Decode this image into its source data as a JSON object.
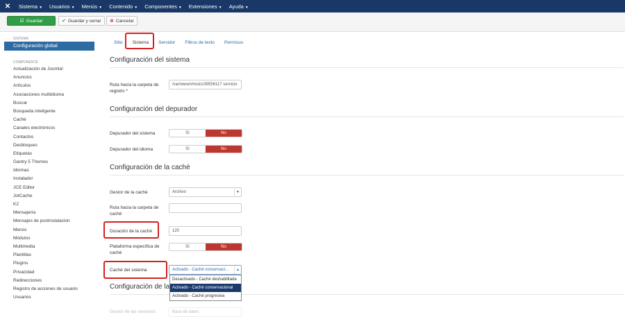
{
  "topbar": {
    "logo": "✕",
    "menu": [
      "Sistema",
      "Usuarios",
      "Menús",
      "Contenido",
      "Componentes",
      "Extensiones",
      "Ayuda"
    ]
  },
  "toolbar": {
    "save_label": "Guardar",
    "save_close_label": "Guardar y cerrar",
    "cancel_label": "Cancelar"
  },
  "sidebar": {
    "system_header": "SISTEMA",
    "active_item": "Configuración global",
    "component_header": "COMPONENTE",
    "items": [
      "Actualización de Joomla!",
      "Anuncios",
      "Artículos",
      "Asociaciones multiidioma",
      "Buscar",
      "Búsqueda inteligente",
      "Caché",
      "Canales electrónicos",
      "Contactos",
      "Desbloqueo",
      "Etiquetas",
      "Gantry 5 Themes",
      "Idiomas",
      "Instalador",
      "JCE Editor",
      "JotCache",
      "K2",
      "Mensajería",
      "Mensajes de postinstalación",
      "Menús",
      "Módulos",
      "Multimedia",
      "Plantillas",
      "Plugins",
      "Privacidad",
      "Redirecciones",
      "Registro de acciones de usuario",
      "Usuarios"
    ]
  },
  "tabs": [
    "Sitio",
    "Sistema",
    "Servidor",
    "Filtros de texto",
    "Permisos"
  ],
  "sections": {
    "system": "Configuración del sistema",
    "debug": "Configuración del depurador",
    "cache": "Configuración de la caché",
    "sessions_partial": "Configuración de las"
  },
  "fields": {
    "registry_path_label": "Ruta hacia la carpeta de registro *",
    "registry_path_value": "/var/www/vhosts/39556117 servicio",
    "debug_system_label": "Depurador del sistema",
    "debug_lang_label": "Depurador del idioma",
    "toggle_yes": "Sí",
    "toggle_no": "No",
    "cache_handler_label": "Gestor de la caché",
    "cache_handler_value": "Archivo",
    "cache_path_label": "Ruta hacia la carpeta de caché",
    "cache_path_value": "",
    "cache_time_label": "Duración de la caché",
    "cache_time_value": "120",
    "platform_label": "Plataforma específica de caché",
    "system_cache_label": "Caché del sistema",
    "system_cache_value": "Activado - Caché conservaci..."
  },
  "dropdown": {
    "options": [
      "Desactivado - Caché deshabilitada",
      "Activado - Caché conservacional",
      "Activado - Caché progresiva"
    ],
    "selected_index": 1
  },
  "hidden_row": {
    "label": "Gestor de las sesiones",
    "value": "Base de datos"
  },
  "colors": {
    "topbar": "#1a3867",
    "save_button": "#2f9e44",
    "toggle_no": "#bd362f",
    "sidebar_active": "#2d6ca2",
    "highlight": "#d41f1f"
  }
}
